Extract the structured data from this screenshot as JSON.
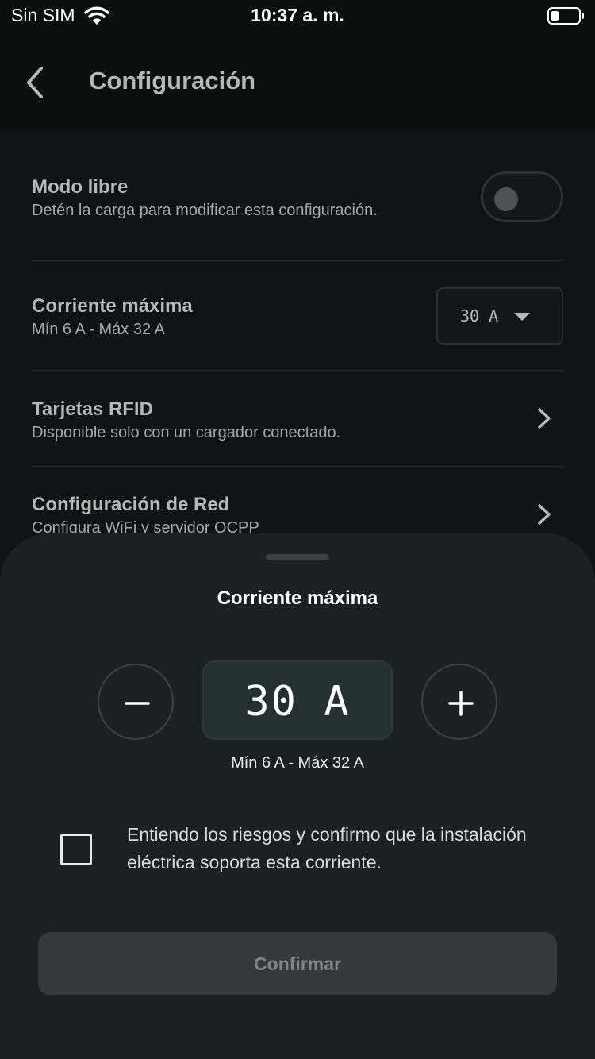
{
  "status_bar": {
    "carrier": "Sin SIM",
    "time": "10:37 a. m.",
    "icons": [
      "wifi-icon",
      "battery-icon"
    ]
  },
  "header": {
    "title": "Configuración",
    "back_icon": "chevron-left-icon"
  },
  "settings": {
    "free_mode": {
      "title": "Modo libre",
      "subtitle": "Detén la carga para modificar esta configuración.",
      "enabled": false
    },
    "max_current": {
      "title": "Corriente máxima",
      "subtitle": "Mín 6 A - Máx 32 A",
      "selected_value": "30 A",
      "caret_icon": "caret-down-icon"
    },
    "rfid": {
      "title": "Tarjetas RFID",
      "subtitle": "Disponible solo con un cargador conectado.",
      "icon": "chevron-right-icon"
    },
    "network": {
      "title": "Configuración de Red",
      "subtitle": "Configura WiFi y servidor OCPP",
      "icon": "chevron-right-icon"
    }
  },
  "sheet": {
    "title": "Corriente máxima",
    "value": "30 A",
    "range": "Mín 6 A - Máx 32 A",
    "minus_icon": "minus-icon",
    "plus_icon": "plus-icon",
    "checkbox_label": "Entiendo los riesgos y confirmo que la instalación eléctrica soporta esta corriente.",
    "checkbox_checked": false,
    "confirm_label": "Confirmar"
  },
  "colors": {
    "background": "#0b100f",
    "sheet": "#1a2221",
    "value_box": "#233130",
    "button_disabled": "#323b3a",
    "text_muted": "#b5b8b7"
  }
}
